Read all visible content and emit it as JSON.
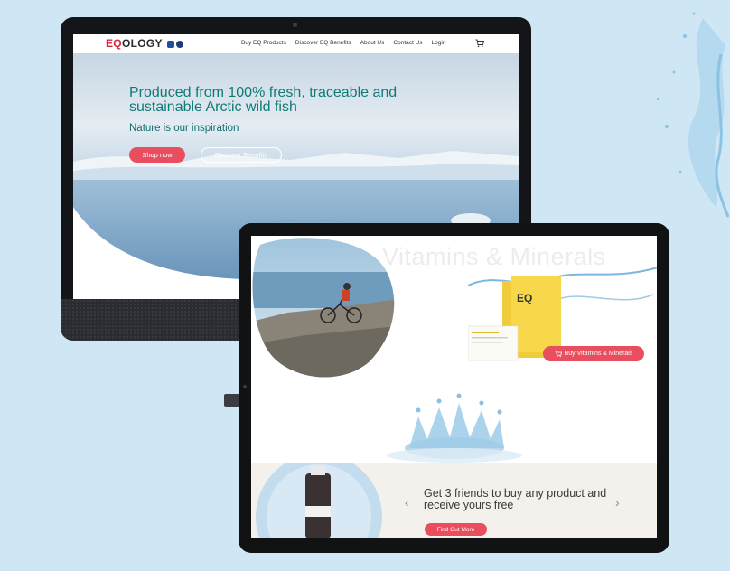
{
  "desktop_site": {
    "logo": {
      "eq": "EQ",
      "rest": "OLOGY"
    },
    "nav": [
      "Buy EQ Products",
      "Discover EQ Benefits",
      "About Us",
      "Contact Us",
      "Login"
    ],
    "hero": {
      "title": "Produced from 100% fresh, traceable and sustainable Arctic wild fish",
      "subtitle": "Nature is our inspiration",
      "shop_button": "Shop now",
      "discover_button": "Discover Benefits"
    }
  },
  "tablet_site": {
    "heading": "Vitamins & Minerals",
    "product_brand": "EQ",
    "buy_button": "Buy Vitamins & Minerals",
    "promo": {
      "text": "Get 3 friends to buy any product and receive yours free",
      "button": "Find Out More"
    }
  },
  "colors": {
    "background": "#cfe6f5",
    "accent": "#e94e5f",
    "hero_text": "#0e7a78",
    "logo_red": "#d7263d"
  },
  "icons": [
    "cart-icon",
    "cart-icon",
    "chevron-left-icon",
    "chevron-right-icon"
  ]
}
